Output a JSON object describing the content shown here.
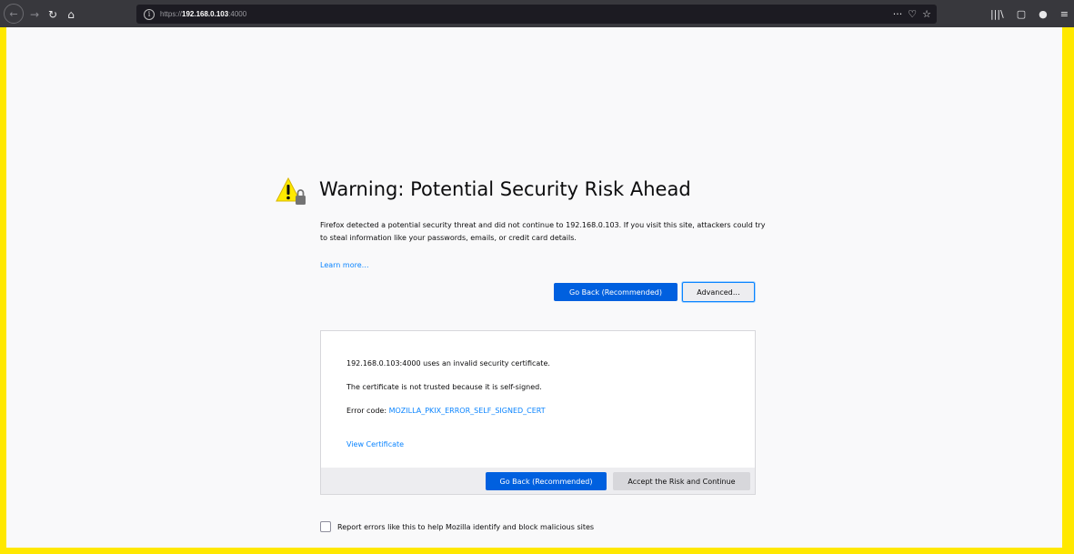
{
  "toolbar": {
    "back_icon": "←",
    "forward_icon": "→",
    "reload_icon": "↻",
    "home_icon": "⌂",
    "url_prefix": "https://",
    "url_host": "192.168.0.103",
    "url_suffix": ":4000",
    "page_actions_icon": "···",
    "pocket_icon": "♡",
    "bookmark_icon": "☆",
    "library_icon": "|||\\",
    "sidebar_icon": "▢",
    "account_icon": "●",
    "menu_icon": "≡"
  },
  "page": {
    "title": "Warning: Potential Security Risk Ahead",
    "description": "Firefox detected a potential security threat and did not continue to 192.168.0.103. If you visit this site, attackers could try to steal information like your passwords, emails, or credit card details.",
    "learn_more": "Learn more…",
    "go_back_label": "Go Back (Recommended)",
    "advanced_label": "Advanced…"
  },
  "advanced": {
    "line1": "192.168.0.103:4000 uses an invalid security certificate.",
    "line2": "The certificate is not trusted because it is self-signed.",
    "error_prefix": "Error code: ",
    "error_code": "MOZILLA_PKIX_ERROR_SELF_SIGNED_CERT",
    "view_certificate": "View Certificate",
    "go_back_label": "Go Back (Recommended)",
    "accept_label": "Accept the Risk and Continue"
  },
  "report": {
    "label": "Report errors like this to help Mozilla identify and block malicious sites",
    "checked": false
  },
  "colors": {
    "border_highlight": "#ffe800",
    "primary_button": "#0060df",
    "link": "#0a84ff",
    "toolbar": "#38383d"
  }
}
